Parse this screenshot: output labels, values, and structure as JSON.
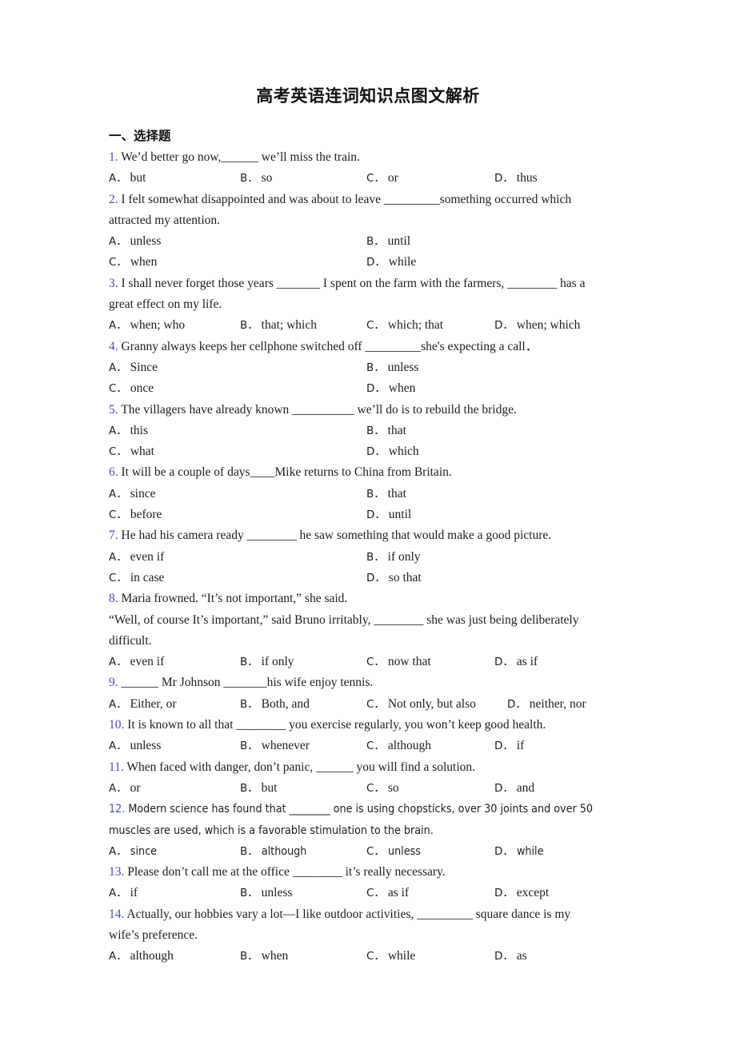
{
  "document": {
    "title": "高考英语连词知识点图文解析",
    "section_heading": "一、选择题",
    "number_color": "#4a4ac4",
    "text_color": "#1d1d1d",
    "background": "#ffffff"
  },
  "questions": [
    {
      "num": "1.",
      "lines": [
        "We’d better go now,______ we’ll miss the train."
      ],
      "layout": "c4",
      "options": [
        {
          "label": "A．",
          "text": "but"
        },
        {
          "label": "B．",
          "text": "so"
        },
        {
          "label": "C．",
          "text": "or"
        },
        {
          "label": "D．",
          "text": "thus"
        }
      ]
    },
    {
      "num": "2.",
      "lines": [
        "I felt somewhat disappointed and was about to leave _________something occurred which",
        "attracted my attention."
      ],
      "layout": "c2",
      "option_rows": [
        [
          {
            "label": "A．",
            "text": "unless"
          },
          {
            "label": "B．",
            "text": "until"
          }
        ],
        [
          {
            "label": "C．",
            "text": "when"
          },
          {
            "label": "D．",
            "text": "while"
          }
        ]
      ]
    },
    {
      "num": "3.",
      "lines": [
        "I shall never forget those years _______ I spent on the farm with the farmers, ________ has a",
        "great effect on my life."
      ],
      "layout": "c4",
      "options": [
        {
          "label": "A．",
          "text": "when; who"
        },
        {
          "label": "B．",
          "text": "that; which"
        },
        {
          "label": "C．",
          "text": "which; that"
        },
        {
          "label": "D．",
          "text": "when; which"
        }
      ]
    },
    {
      "num": "4.",
      "lines": [
        "Granny always keeps her cellphone switched off _________she's expecting a call．"
      ],
      "layout": "c2",
      "option_rows": [
        [
          {
            "label": "A．",
            "text": "Since"
          },
          {
            "label": "B．",
            "text": "unless"
          }
        ],
        [
          {
            "label": "C．",
            "text": "once"
          },
          {
            "label": "D．",
            "text": "when"
          }
        ]
      ]
    },
    {
      "num": "5.",
      "lines": [
        "The villagers have already known __________ we’ll do is to rebuild the bridge."
      ],
      "layout": "c2",
      "option_rows": [
        [
          {
            "label": "A．",
            "text": "this"
          },
          {
            "label": "B．",
            "text": "that"
          }
        ],
        [
          {
            "label": "C．",
            "text": "what"
          },
          {
            "label": "D．",
            "text": "which"
          }
        ]
      ]
    },
    {
      "num": "6.",
      "lines": [
        "It will be a couple of days____Mike returns to China from Britain."
      ],
      "layout": "c2",
      "option_rows": [
        [
          {
            "label": "A．",
            "text": "since"
          },
          {
            "label": "B．",
            "text": "that"
          }
        ],
        [
          {
            "label": "C．",
            "text": "before"
          },
          {
            "label": "D．",
            "text": "until"
          }
        ]
      ]
    },
    {
      "num": "7.",
      "lines": [
        "He had his camera ready ________ he saw something that would make a good picture."
      ],
      "layout": "c2",
      "option_rows": [
        [
          {
            "label": "A．",
            "text": "even if"
          },
          {
            "label": "B．",
            "text": "if only"
          }
        ],
        [
          {
            "label": "C．",
            "text": "in case"
          },
          {
            "label": "D．",
            "text": "so that"
          }
        ]
      ]
    },
    {
      "num": "8.",
      "lines": [
        "Maria frowned. “It’s not important,” she said.",
        "“Well, of course It’s important,” said Bruno irritably, ________ she was just being deliberately",
        "difficult."
      ],
      "layout": "c4",
      "options": [
        {
          "label": "A．",
          "text": "even if"
        },
        {
          "label": "B．",
          "text": "if only"
        },
        {
          "label": "C．",
          "text": "now that"
        },
        {
          "label": "D．",
          "text": "as if"
        }
      ]
    },
    {
      "num": "9.",
      "lines": [
        "______ Mr Johnson _______his wife enjoy tennis."
      ],
      "layout": "c4n",
      "options": [
        {
          "label": "A．",
          "text": "Either, or"
        },
        {
          "label": "B．",
          "text": "Both, and"
        },
        {
          "label": "C．",
          "text": "Not only, but also"
        },
        {
          "label": "D．",
          "text": "neither, nor"
        }
      ]
    },
    {
      "num": "10.",
      "lines": [
        "It is known to all that ________ you exercise regularly, you won’t keep good health."
      ],
      "layout": "c4",
      "options": [
        {
          "label": "A．",
          "text": "unless"
        },
        {
          "label": "B．",
          "text": "whenever"
        },
        {
          "label": "C．",
          "text": "although"
        },
        {
          "label": "D．",
          "text": "if"
        }
      ]
    },
    {
      "num": "11.",
      "lines": [
        "When faced with danger, don’t panic, ______ you will find a solution."
      ],
      "layout": "c4",
      "options": [
        {
          "label": "A．",
          "text": "or"
        },
        {
          "label": "B．",
          "text": "but"
        },
        {
          "label": "C．",
          "text": "so"
        },
        {
          "label": "D．",
          "text": "and"
        }
      ]
    },
    {
      "num": "12.",
      "font": "sans",
      "lines": [
        "Modern science has found that ________ one is using chopsticks, over 30 joints and over 50",
        "muscles are used, which is a favorable stimulation to the brain."
      ],
      "layout": "c4",
      "options": [
        {
          "label": "A．",
          "text": "since"
        },
        {
          "label": "B．",
          "text": "although"
        },
        {
          "label": "C．",
          "text": "unless"
        },
        {
          "label": "D．",
          "text": "while"
        }
      ]
    },
    {
      "num": "13.",
      "lines": [
        "Please don’t call me at the office ________ it’s really necessary."
      ],
      "layout": "c4",
      "options": [
        {
          "label": "A．",
          "text": "if"
        },
        {
          "label": "B．",
          "text": "unless"
        },
        {
          "label": "C．",
          "text": "as if"
        },
        {
          "label": "D．",
          "text": "except"
        }
      ]
    },
    {
      "num": "14.",
      "lines": [
        "Actually, our hobbies vary a lot—I like outdoor activities, _________ square dance is my",
        "wife’s preference."
      ],
      "layout": "c4",
      "options": [
        {
          "label": "A．",
          "text": "although"
        },
        {
          "label": "B．",
          "text": "when"
        },
        {
          "label": "C．",
          "text": "while"
        },
        {
          "label": "D．",
          "text": "as"
        }
      ]
    }
  ]
}
